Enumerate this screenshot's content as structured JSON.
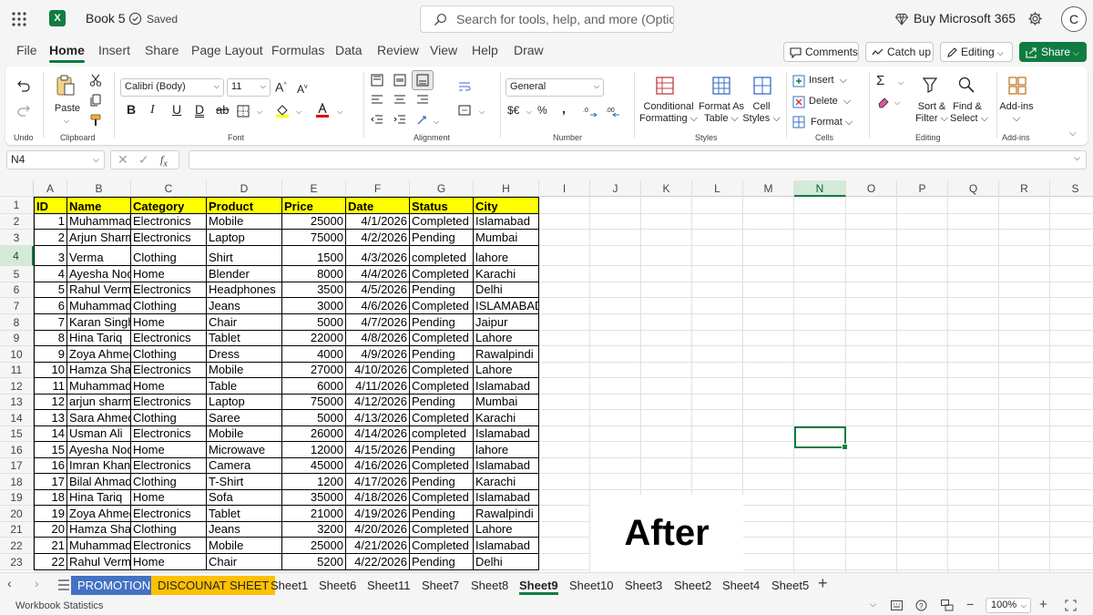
{
  "titlebar": {
    "app_letter": "X",
    "book_name": "Book 5",
    "saved_label": "Saved",
    "search_placeholder": "Search for tools, help, and more (Option + Q)",
    "buy_label": "Buy Microsoft 365",
    "avatar_initial": "C"
  },
  "menu": [
    "File",
    "Home",
    "Insert",
    "Share",
    "Page Layout",
    "Formulas",
    "Data",
    "Review",
    "View",
    "Help",
    "Draw"
  ],
  "active_menu": "Home",
  "top_buttons": {
    "comments": "Comments",
    "catch_up": "Catch up",
    "editing": "Editing",
    "share": "Share"
  },
  "ribbon": {
    "undo_group": "Undo",
    "clipboard": {
      "paste": "Paste",
      "group": "Clipboard"
    },
    "font": {
      "name": "Calibri (Body)",
      "size": "11",
      "group": "Font"
    },
    "alignment": {
      "group": "Alignment"
    },
    "number": {
      "format": "General",
      "group": "Number"
    },
    "styles": {
      "cond_line1": "Conditional",
      "cond_line2": "Formatting",
      "table_line1": "Format As",
      "table_line2": "Table",
      "cell_line1": "Cell",
      "cell_line2": "Styles",
      "group": "Styles"
    },
    "cells": {
      "insert": "Insert",
      "delete": "Delete",
      "format": "Format",
      "group": "Cells"
    },
    "editing": {
      "sort_line1": "Sort &",
      "sort_line2": "Filter",
      "find_line1": "Find &",
      "find_line2": "Select",
      "group": "Editing"
    },
    "addins": {
      "label": "Add-ins",
      "group": "Add-ins"
    }
  },
  "formula_bar": {
    "name_box": "N4",
    "formula": ""
  },
  "grid": {
    "columns": [
      "A",
      "B",
      "C",
      "D",
      "E",
      "F",
      "G",
      "H",
      "I",
      "J",
      "K",
      "L",
      "M",
      "N",
      "O",
      "P",
      "Q",
      "R",
      "S"
    ],
    "selected_column": "N",
    "selected_row": "4",
    "rows": [
      [
        "ID",
        "Name",
        "Category",
        "Product",
        "Price",
        "Date",
        "Status",
        "City"
      ],
      [
        "1",
        "Muhammad",
        "Electronics",
        "Mobile",
        "25000",
        "4/1/2026",
        "Completed",
        "Islamabad"
      ],
      [
        "2",
        "Arjun Sharma",
        "Electronics",
        "Laptop",
        "75000",
        "4/2/2026",
        "Pending",
        "Mumbai"
      ],
      [
        "3",
        "Verma",
        "Clothing",
        "Shirt",
        "1500",
        "4/3/2026",
        "completed",
        "lahore"
      ],
      [
        "4",
        "Ayesha Noor",
        "Home",
        "Blender",
        "8000",
        "4/4/2026",
        "Completed",
        "Karachi"
      ],
      [
        "5",
        "Rahul Verma",
        "Electronics",
        "Headphones",
        "3500",
        "4/5/2026",
        "Pending",
        "Delhi"
      ],
      [
        "6",
        "Muhammad",
        "Clothing",
        "Jeans",
        "3000",
        "4/6/2026",
        "Completed",
        "ISLAMABAD"
      ],
      [
        "7",
        "Karan Singh",
        "Home",
        "Chair",
        "5000",
        "4/7/2026",
        "Pending",
        "Jaipur"
      ],
      [
        "8",
        "Hina Tariq",
        "Electronics",
        "Tablet",
        "22000",
        "4/8/2026",
        "Completed",
        "Lahore"
      ],
      [
        "9",
        "Zoya Ahmed",
        "Clothing",
        "Dress",
        "4000",
        "4/9/2026",
        "Pending",
        "Rawalpindi"
      ],
      [
        "10",
        "Hamza Shah",
        "Electronics",
        "Mobile",
        "27000",
        "4/10/2026",
        "Completed",
        "Lahore"
      ],
      [
        "11",
        "Muhammad",
        "Home",
        "Table",
        "6000",
        "4/11/2026",
        "Completed",
        "Islamabad"
      ],
      [
        "12",
        "arjun sharma",
        "Electronics",
        "Laptop",
        "75000",
        "4/12/2026",
        "Pending",
        "Mumbai"
      ],
      [
        "13",
        "Sara Ahmed",
        "Clothing",
        "Saree",
        "5000",
        "4/13/2026",
        "Completed",
        "Karachi"
      ],
      [
        "14",
        "Usman Ali",
        "Electronics",
        "Mobile",
        "26000",
        "4/14/2026",
        "completed",
        "Islamabad"
      ],
      [
        "15",
        "Ayesha Noor",
        "Home",
        "Microwave",
        "12000",
        "4/15/2026",
        "Pending",
        "lahore"
      ],
      [
        "16",
        "Imran Khan",
        "Electronics",
        "Camera",
        "45000",
        "4/16/2026",
        "Completed",
        "Islamabad"
      ],
      [
        "17",
        "Bilal Ahmad",
        "Clothing",
        "T-Shirt",
        "1200",
        "4/17/2026",
        "Pending",
        "Karachi"
      ],
      [
        "18",
        "Hina Tariq",
        "Home",
        "Sofa",
        "35000",
        "4/18/2026",
        "Completed",
        "Islamabad"
      ],
      [
        "19",
        "Zoya Ahmed",
        "Electronics",
        "Tablet",
        "21000",
        "4/19/2026",
        "Pending",
        "Rawalpindi"
      ],
      [
        "20",
        "Hamza Shah",
        "Clothing",
        "Jeans",
        "3200",
        "4/20/2026",
        "Completed",
        "Lahore"
      ],
      [
        "21",
        "Muhammad",
        "Electronics",
        "Mobile",
        "25000",
        "4/21/2026",
        "Completed",
        "Islamabad"
      ],
      [
        "22",
        "Rahul Verma",
        "Home",
        "Chair",
        "5200",
        "4/22/2026",
        "Pending",
        "Delhi"
      ]
    ],
    "overlay_text": "After"
  },
  "sheets": [
    "PROMOTION",
    "DISCOUNAT SHEET",
    "Sheet1",
    "Sheet6",
    "Sheet11",
    "Sheet7",
    "Sheet8",
    "Sheet9",
    "Sheet10",
    "Sheet3",
    "Sheet2",
    "Sheet4",
    "Sheet5"
  ],
  "active_sheet": "Sheet9",
  "status": {
    "left": "Workbook Statistics",
    "zoom": "100%"
  },
  "colors": {
    "accent": "#107c41",
    "header_fill": "#ffff00",
    "promotion_tab": "#4472c4",
    "discount_tab": "#ffc000"
  }
}
